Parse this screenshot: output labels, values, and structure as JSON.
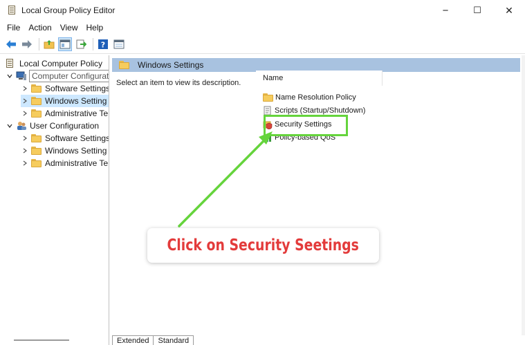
{
  "window": {
    "title": "Local Group Policy Editor",
    "controls": {
      "minimize": "−",
      "maximize": "☐",
      "close": "✕"
    }
  },
  "menu": [
    "File",
    "Action",
    "View",
    "Help"
  ],
  "toolbar": {
    "buttons": [
      "back-arrow-icon",
      "forward-arrow-icon",
      "up-folder-icon",
      "show-hide-tree-icon",
      "export-list-icon",
      "help-icon",
      "properties-icon"
    ]
  },
  "tree": {
    "root": "Local Computer Policy",
    "computer_config": "Computer Configuration",
    "computer_children": [
      "Software Settings",
      "Windows Setting",
      "Administrative Te"
    ],
    "user_config": "User Configuration",
    "user_children": [
      "Software Settings",
      "Windows Setting",
      "Administrative Te"
    ]
  },
  "pane": {
    "header_title": "Windows Settings",
    "description": "Select an item to view its description.",
    "list_header": "Name",
    "items": [
      "Name Resolution Policy",
      "Scripts (Startup/Shutdown)",
      "Security Settings",
      "Policy-based QoS"
    ]
  },
  "annotation": {
    "callout": "Click on Security Seetings",
    "accent_color": "#65d43c",
    "text_color": "#e33b3b"
  },
  "tabs": [
    "Extended",
    "Standard"
  ]
}
